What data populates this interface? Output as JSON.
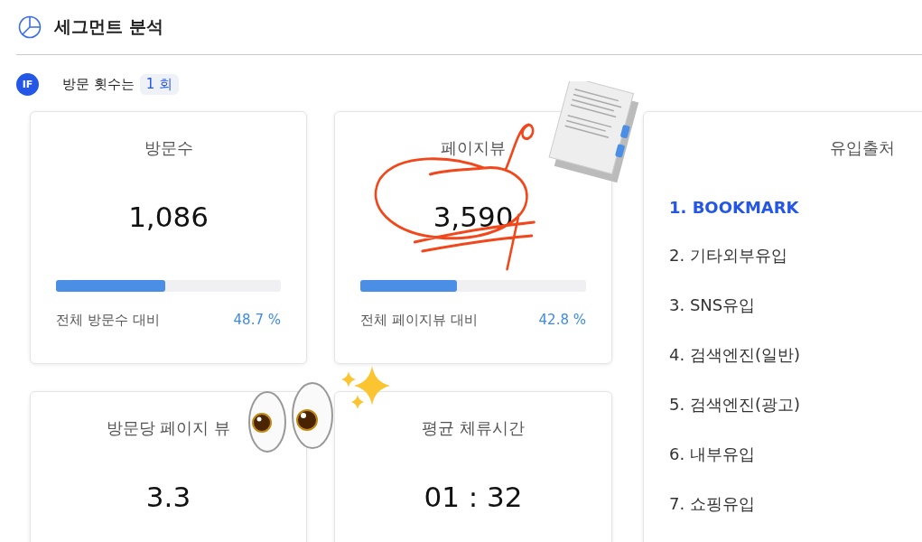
{
  "header": {
    "title": "세그먼트 분석"
  },
  "condition": {
    "badge": "IF",
    "label": "방문 횟수는",
    "value": "1 회"
  },
  "metrics": [
    {
      "title": "방문수",
      "value": "1,086",
      "level": 0.487,
      "caption": "전체 방문수 대비",
      "percent": "48.7 %"
    },
    {
      "title": "페이지뷰",
      "value": "3,590",
      "level": 0.428,
      "caption": "전체 페이지뷰 대비",
      "percent": "42.8 %"
    },
    {
      "title": "방문당 페이지 뷰",
      "value": "3.3"
    },
    {
      "title": "평균 체류시간",
      "value": "01 : 32"
    }
  ],
  "sources": {
    "title": "유입출처",
    "items": [
      {
        "label": "1. BOOKMARK",
        "selected": true
      },
      {
        "label": "2. 기타외부유입",
        "selected": false
      },
      {
        "label": "3. SNS유입",
        "selected": false
      },
      {
        "label": "4. 검색엔진(일반)",
        "selected": false
      },
      {
        "label": "5. 검색엔진(광고)",
        "selected": false
      },
      {
        "label": "6. 내부유입",
        "selected": false
      },
      {
        "label": "7. 쇼핑유입",
        "selected": false
      }
    ]
  }
}
